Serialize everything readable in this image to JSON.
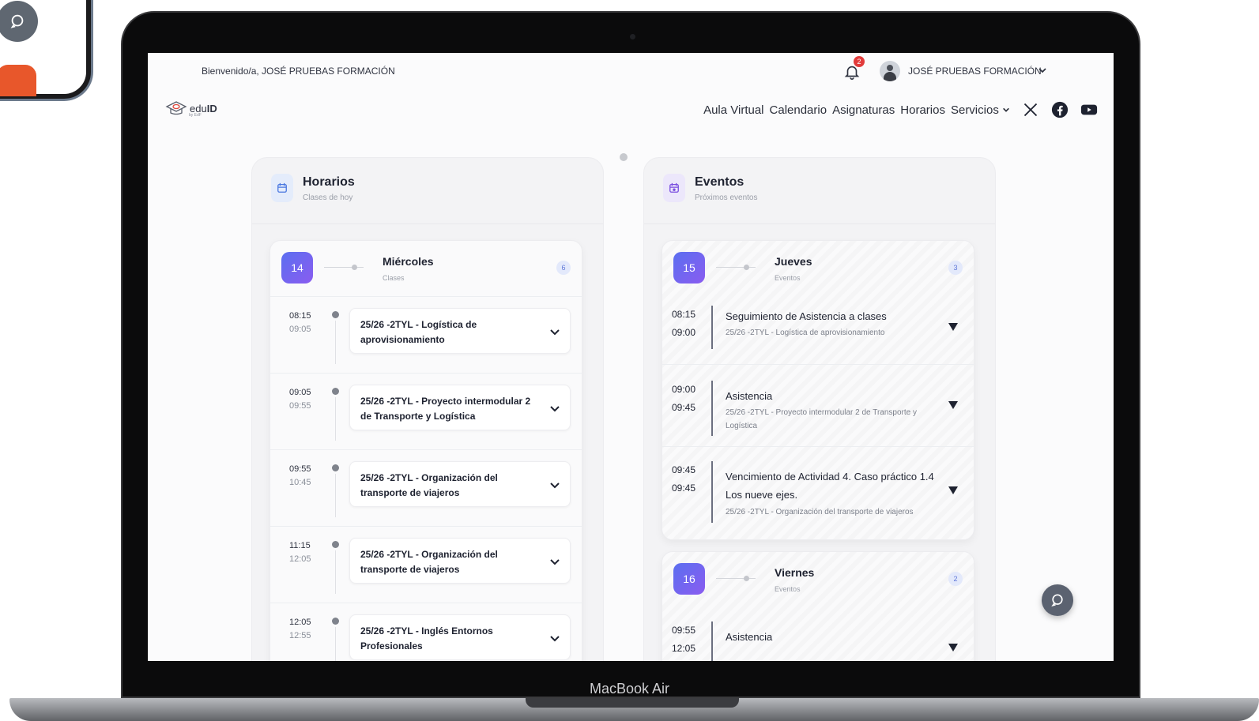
{
  "device": {
    "brand": "MacBook Air"
  },
  "topbar": {
    "welcome": "Bienvenido/a, JOSÉ PRUEBAS FORMACIÓN",
    "notification_count": "2",
    "user_name": "JOSÉ PRUEBAS FORMACIÓN"
  },
  "logo": {
    "name_prefix": "edu",
    "name_bold": "ID",
    "tagline": "by EdF"
  },
  "nav": {
    "items": [
      "Aula Virtual",
      "Calendario",
      "Asignaturas",
      "Horarios",
      "Servicios"
    ],
    "social": [
      "x-icon",
      "facebook-icon",
      "youtube-icon"
    ]
  },
  "horarios": {
    "title": "Horarios",
    "subtitle": "Clases de hoy",
    "day": {
      "number": "14",
      "name": "Miércoles",
      "sub": "Clases",
      "count": "6"
    },
    "classes": [
      {
        "start": "08:15",
        "end": "09:05",
        "name": "25/26 -2TYL - Logística de aprovisionamiento"
      },
      {
        "start": "09:05",
        "end": "09:55",
        "name": "25/26 -2TYL - Proyecto intermodular 2 de Transporte y Logística"
      },
      {
        "start": "09:55",
        "end": "10:45",
        "name": "25/26 -2TYL - Organización del transporte de viajeros"
      },
      {
        "start": "11:15",
        "end": "12:05",
        "name": "25/26 -2TYL - Organización del transporte de viajeros"
      },
      {
        "start": "12:05",
        "end": "12:55",
        "name": "25/26 -2TYL - Inglés Entornos Profesionales"
      }
    ]
  },
  "eventos": {
    "title": "Eventos",
    "subtitle": "Próximos eventos",
    "days": [
      {
        "number": "15",
        "name": "Jueves",
        "sub": "Eventos",
        "count": "3",
        "events": [
          {
            "start": "08:15",
            "end": "09:00",
            "title": "Seguimiento de Asistencia a clases",
            "subject": "25/26 -2TYL - Logística de aprovisionamiento"
          },
          {
            "start": "09:00",
            "end": "09:45",
            "title": "Asistencia",
            "subject": "25/26 -2TYL - Proyecto intermodular 2 de Transporte y Logística"
          },
          {
            "start": "09:45",
            "end": "09:45",
            "title": "Vencimiento de Actividad 4. Caso práctico 1.4 Los nueve ejes.",
            "subject": "25/26 -2TYL - Organización del transporte de viajeros"
          }
        ]
      },
      {
        "number": "16",
        "name": "Viernes",
        "sub": "Eventos",
        "count": "2",
        "events": [
          {
            "start": "09:55",
            "end": "12:05",
            "title": "Asistencia",
            "subject": ""
          }
        ]
      }
    ]
  },
  "colors": {
    "accent_gradient_start": "#5b6ff0",
    "accent_gradient_end": "#8a5cf0",
    "notification_badge": "#e23b3b"
  }
}
